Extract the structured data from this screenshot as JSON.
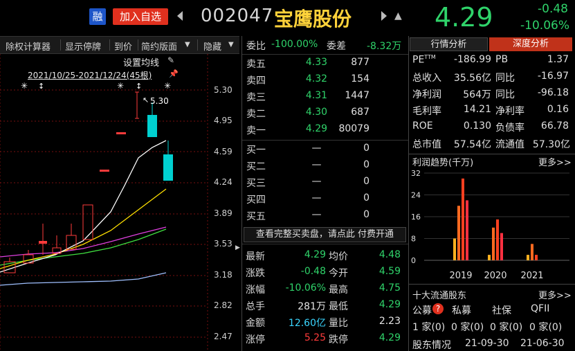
{
  "header": {
    "rong_label": "融",
    "add_favorite": "加入自选",
    "stock_code": "002047",
    "stock_name": "宝鹰股份",
    "price": "4.29",
    "change": "-0.48",
    "change_pct": "-10.06%"
  },
  "toolbar": {
    "items": [
      "除权计算器",
      "显示停牌",
      "到价",
      "简约版面",
      "隐藏"
    ]
  },
  "chart": {
    "ma_label": "设置均线",
    "date_range": "2021/10/25-2021/12/24(45根)",
    "max_label": "5.30",
    "y_ticks": [
      "5.30",
      "4.95",
      "4.59",
      "4.24",
      "3.89",
      "3.53",
      "3.18",
      "2.82",
      "2.47"
    ],
    "colors": {
      "up": "#ff3b3b",
      "down": "#00d0d0",
      "ma5": "#ffffff",
      "ma10": "#ffe000",
      "ma20": "#e040e0",
      "ma30": "#40e040",
      "ma60": "#a0c0ff"
    }
  },
  "orderbook": {
    "weibi_label": "委比",
    "weibi_value": "-100.00%",
    "weicha_label": "委差",
    "weicha_value": "-8.32万",
    "asks": [
      {
        "label": "卖五",
        "price": "4.33",
        "vol": "877"
      },
      {
        "label": "卖四",
        "price": "4.32",
        "vol": "154"
      },
      {
        "label": "卖三",
        "price": "4.31",
        "vol": "1447"
      },
      {
        "label": "卖二",
        "price": "4.30",
        "vol": "687"
      },
      {
        "label": "卖一",
        "price": "4.29",
        "vol": "80079"
      }
    ],
    "bids": [
      {
        "label": "买一",
        "price": "—",
        "vol": "0"
      },
      {
        "label": "买二",
        "price": "—",
        "vol": "0"
      },
      {
        "label": "买三",
        "price": "—",
        "vol": "0"
      },
      {
        "label": "买四",
        "price": "—",
        "vol": "0"
      },
      {
        "label": "买五",
        "price": "—",
        "vol": "0"
      }
    ],
    "more_text": "查看完整买卖盘，请点此 付费开通"
  },
  "stats": [
    {
      "l1": "最新",
      "v1": "4.29",
      "c1": "green",
      "l2": "均价",
      "v2": "4.48",
      "c2": "green"
    },
    {
      "l1": "涨跌",
      "v1": "-0.48",
      "c1": "green",
      "l2": "今开",
      "v2": "4.59",
      "c2": "green"
    },
    {
      "l1": "涨幅",
      "v1": "-10.06%",
      "c1": "green",
      "l2": "最高",
      "v2": "4.75",
      "c2": "green"
    },
    {
      "l1": "总手",
      "v1": "281万",
      "c1": "white",
      "l2": "最低",
      "v2": "4.29",
      "c2": "green"
    },
    {
      "l1": "金额",
      "v1": "12.60亿",
      "c1": "cyan",
      "l2": "量比",
      "v2": "2.23",
      "c2": "white"
    },
    {
      "l1": "涨停",
      "v1": "5.25",
      "c1": "red",
      "l2": "跌停",
      "v2": "4.29",
      "c2": "green"
    }
  ],
  "right_panel": {
    "tab_industry": "行情分析",
    "tab_depth": "深度分析",
    "fin": [
      {
        "l1": "PE",
        "sup": "TTM",
        "v1": "-186.99",
        "l2": "PB",
        "v2": "1.37"
      },
      {
        "l1": "总收入",
        "v1": "35.56亿",
        "l2": "同比",
        "v2": "-16.97"
      },
      {
        "l1": "净利润",
        "v1": "564万",
        "l2": "同比",
        "v2": "-96.18"
      },
      {
        "l1": "毛利率",
        "v1": "14.21",
        "l2": "净利率",
        "v2": "0.16"
      },
      {
        "l1": "ROE",
        "v1": "0.130",
        "l2": "负债率",
        "v2": "66.78"
      },
      {
        "l1": "总市值",
        "v1": "57.54亿",
        "l2": "流通值",
        "v2": "57.30亿"
      }
    ],
    "profit_title": "利润趋势(千万)",
    "more": "更多>>",
    "holders_title": "十大流通股东",
    "holder_types": [
      "公募",
      "私募",
      "社保",
      "QFII"
    ],
    "holder_counts": [
      "1 家(0)",
      "0 家(0)",
      "0 家(0)",
      "0 家(0)"
    ],
    "holder_info_label": "股东情况",
    "holder_dates": [
      "21-09-30",
      "21-06-30"
    ]
  },
  "chart_data": {
    "type": "bar",
    "title": "利润趋势(千万)",
    "categories": [
      "2019",
      "2020",
      "2021"
    ],
    "yticks": [
      0,
      8,
      16,
      24,
      32
    ],
    "ylim": [
      0,
      32
    ],
    "groups": [
      {
        "year": "2019",
        "values": [
          8,
          20,
          30,
          22
        ]
      },
      {
        "year": "2020",
        "values": [
          2,
          12,
          15,
          10
        ]
      },
      {
        "year": "2021",
        "values": [
          2,
          6,
          2
        ]
      }
    ]
  }
}
